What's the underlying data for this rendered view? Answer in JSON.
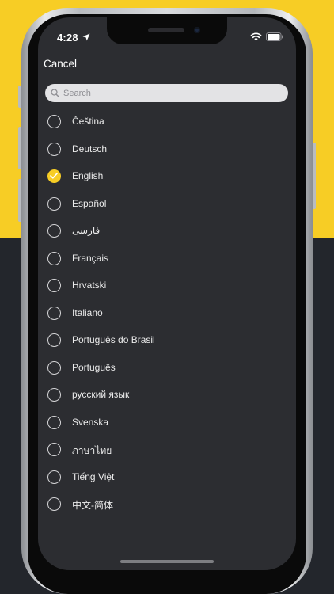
{
  "status_bar": {
    "time": "4:28"
  },
  "header": {
    "cancel_label": "Cancel"
  },
  "search": {
    "placeholder": "Search",
    "value": ""
  },
  "languages": [
    {
      "label": "Čeština",
      "selected": false
    },
    {
      "label": "Deutsch",
      "selected": false
    },
    {
      "label": "English",
      "selected": true
    },
    {
      "label": "Español",
      "selected": false
    },
    {
      "label": "فارسی",
      "selected": false
    },
    {
      "label": "Français",
      "selected": false
    },
    {
      "label": "Hrvatski",
      "selected": false
    },
    {
      "label": "Italiano",
      "selected": false
    },
    {
      "label": "Português do Brasil",
      "selected": false
    },
    {
      "label": "Português",
      "selected": false
    },
    {
      "label": "русский язык",
      "selected": false
    },
    {
      "label": "Svenska",
      "selected": false
    },
    {
      "label": "ภาษาไทย",
      "selected": false
    },
    {
      "label": "Tiếng Việt",
      "selected": false
    },
    {
      "label": "中文-简体",
      "selected": false
    }
  ],
  "colors": {
    "accent": "#f7cd25",
    "screen_background": "#2c2d31",
    "page_background_dark": "#23262c"
  },
  "icons": {
    "location": "location-arrow-icon",
    "wifi": "wifi-icon",
    "battery": "battery-icon",
    "search": "search-icon",
    "check": "checkmark-icon"
  }
}
